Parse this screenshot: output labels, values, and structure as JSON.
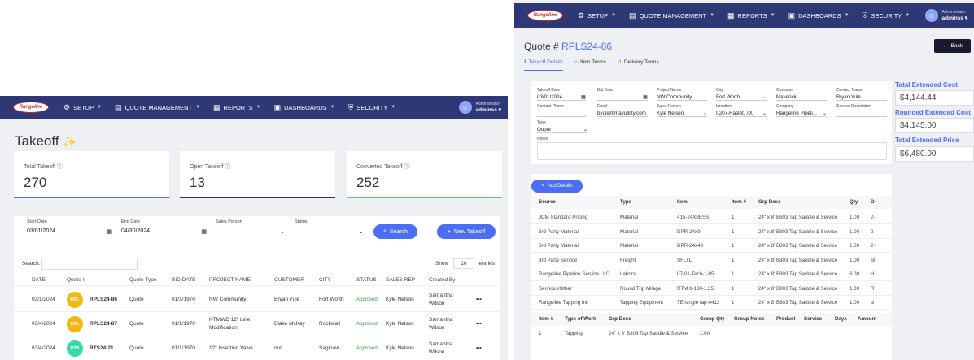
{
  "nav": {
    "logo": "Rangeline",
    "items": [
      {
        "label": "SETUP"
      },
      {
        "label": "QUOTE MANAGEMENT"
      },
      {
        "label": "REPORTS"
      },
      {
        "label": "DASHBOARDS"
      },
      {
        "label": "SECURITY"
      }
    ],
    "user_role": "Administrator",
    "user_name": "adminss"
  },
  "left": {
    "title": "Takeoff",
    "cards": [
      {
        "label": "Total Takeoff",
        "value": "270",
        "color": "#4c6ef5"
      },
      {
        "label": "Open Takeoff",
        "value": "13",
        "color": "#2d3748"
      },
      {
        "label": "Converted Takeoff",
        "value": "252",
        "color": "#51cf66"
      }
    ],
    "filters": {
      "start_label": "Start Date",
      "start_value": "03/01/2024",
      "end_label": "End Date",
      "end_value": "04/30/2024",
      "sales_label": "Sales Person",
      "status_label": "Status"
    },
    "search_button": "Search",
    "new_button": "New Takeoff",
    "search_label": "Search:",
    "show_label": "Show",
    "show_value": "10",
    "entries_label": "entries",
    "columns": [
      "DATE",
      "Quote #",
      "Quote Type",
      "BID DATE",
      "PROJECT NAME",
      "CUSTOMER",
      "CITY",
      "STATUS",
      "SALES REP",
      "Created By"
    ],
    "rows": [
      {
        "date": "03/1/2024",
        "badge": "RPL",
        "badge_color": "#f5b60f",
        "quote": "RPLS24-86",
        "type": "Quote",
        "bid": "01/1/1970",
        "project": "NW Community",
        "customer": "Bryan Yule",
        "city": "Fort Worth",
        "status": "Approved",
        "rep": "Kyle Nelson",
        "created1": "Samantha",
        "created2": "Wilson"
      },
      {
        "date": "03/4/2024",
        "badge": "RPL",
        "badge_color": "#f5b60f",
        "quote": "RPLS24-87",
        "type": "Quote",
        "bid": "01/1/1970",
        "project": "NTMWD 12\" Line",
        "project2": "Modification",
        "customer": "Blake McKay",
        "city": "Rockwall",
        "status": "Approved",
        "rep": "Kyle Nelson",
        "created1": "Samantha",
        "created2": "Wilson"
      },
      {
        "date": "03/4/2024",
        "badge": "RTS",
        "badge_color": "#38d9a9",
        "quote": "RTS24-21",
        "type": "Quote",
        "bid": "01/1/1970",
        "project": "12\" Insertion Valve",
        "customer": "null",
        "city": "Saginaw",
        "status": "Approved",
        "rep": "Kyle Nelson",
        "created1": "Samantha",
        "created2": "Wilson"
      }
    ]
  },
  "right": {
    "title_prefix": "Quote #",
    "quote_no": "RPLS24-86",
    "back": "Back",
    "tabs": [
      "Takeoff Details",
      "Item Terms",
      "Delivery Terms"
    ],
    "fields": [
      {
        "label": "Takeoff Date",
        "value": "03/01/2024"
      },
      {
        "label": "Bid Date",
        "value": ""
      },
      {
        "label": "Project Name",
        "value": "NW Community"
      },
      {
        "label": "City",
        "value": "Fort Worth"
      },
      {
        "label": "Customer",
        "value": "Maverick"
      },
      {
        "label": "Contact Name",
        "value": "Bryan Yule"
      },
      {
        "label": "Contact Phone",
        "value": ""
      },
      {
        "label": "Email",
        "value": "byule@mavutility.com"
      },
      {
        "label": "Sales Person",
        "value": "Kyle Nelson"
      },
      {
        "label": "Location",
        "value": "I-207-Haslet, TX"
      },
      {
        "label": "Company",
        "value": "Rangeline Pipeli..."
      },
      {
        "label": "Service Description",
        "value": ""
      },
      {
        "label": "Type",
        "value": "Quote"
      },
      {
        "label": "Notes",
        "value": ""
      }
    ],
    "totals": [
      {
        "label": "Total Extended Cost",
        "value": "$4,144.44"
      },
      {
        "label": "Rounded Extended Cost",
        "value": "$4,145.00"
      },
      {
        "label": "Total Extended Price",
        "value": "$6,480.00"
      }
    ],
    "add_details": "Add Details",
    "detail_columns": [
      "Source",
      "Type",
      "Item",
      "Item #",
      "Grp Desc",
      "Qty",
      "D-"
    ],
    "detail_rows": [
      [
        "JCM Standard Pricing",
        "Material",
        "415-24X8ESS",
        "1",
        "24\" x 8' B303 Tap Saddle & Service",
        "1.00",
        "2-"
      ],
      [
        "3rd Party Material",
        "Material",
        "DPR-24x9",
        "1",
        "24\" x 8' B303 Tap Saddle & Service",
        "1.00",
        "2-"
      ],
      [
        "3rd Party Material",
        "Material",
        "DPR-24x48",
        "1",
        "24\" x 8' B303 Tap Saddle & Service",
        "1.00",
        "2-"
      ],
      [
        "3rd Party Service",
        "Freight",
        "SFLTL",
        "1",
        "24\" x 8' B303 Tap Saddle & Service",
        "1.00",
        "Sl"
      ],
      [
        "Rangeline Pipeline Service LLC",
        "Labors",
        "07-01-Tech-1-95",
        "1",
        "24\" x 8' B303 Tap Saddle & Service",
        "6.00",
        "H"
      ],
      [
        "Services/Other",
        "Round Trip Milage",
        "RTM 0-100-1.35",
        "1",
        "24\" x 8' B303 Tap Saddle & Service",
        "1.00",
        "R"
      ],
      [
        "Rangeline Tapping Inc",
        "Tapping Equipment",
        "TE-single tap-0412",
        "1",
        "24\" x 8' B303 Tap Saddle & Service",
        "1.00",
        "si"
      ]
    ],
    "item_columns": [
      "Item #",
      "Type of Work",
      "Grp Desc",
      "Group Qty",
      "Group Notes",
      "Product",
      "Service",
      "Days",
      "Amount"
    ],
    "item_rows": [
      [
        "1",
        "Tapping",
        "24\" x 8' B303 Tap Saddle & Service",
        "1.00",
        "",
        "",
        "",
        "",
        ""
      ]
    ]
  }
}
